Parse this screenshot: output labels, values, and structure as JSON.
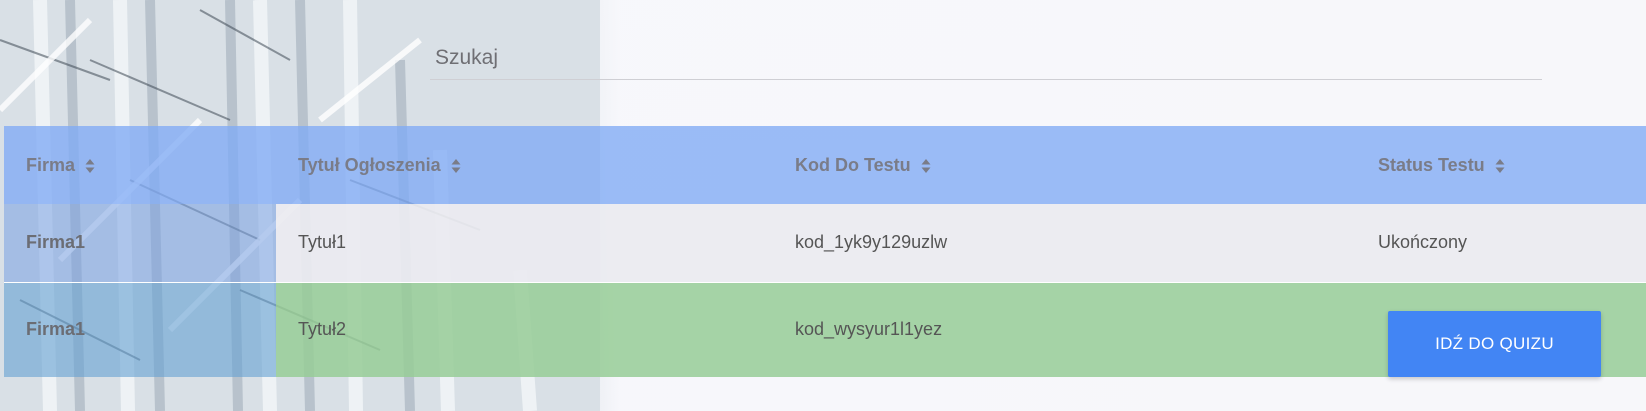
{
  "search": {
    "placeholder": "Szukaj",
    "value": ""
  },
  "table": {
    "columns": [
      "Firma",
      "Tytuł Ogłoszenia",
      "Kod Do Testu",
      "Status Testu"
    ],
    "rows": [
      {
        "firma": "Firma1",
        "tytul": "Tytuł1",
        "kod": "kod_1yk9y129uzlw",
        "status": "Ukończony"
      },
      {
        "firma": "Firma1",
        "tytul": "Tytuł2",
        "kod": "kod_wysyur1l1yez",
        "action_label": "IDŹ DO QUIZU"
      }
    ]
  },
  "colors": {
    "header_bg": "#80aaf5",
    "row_complete_bg": "#ebebf0",
    "row_pending_bg": "#96cd96",
    "button_bg": "#4285f4"
  },
  "icons": {
    "sort": "sort-icon"
  }
}
